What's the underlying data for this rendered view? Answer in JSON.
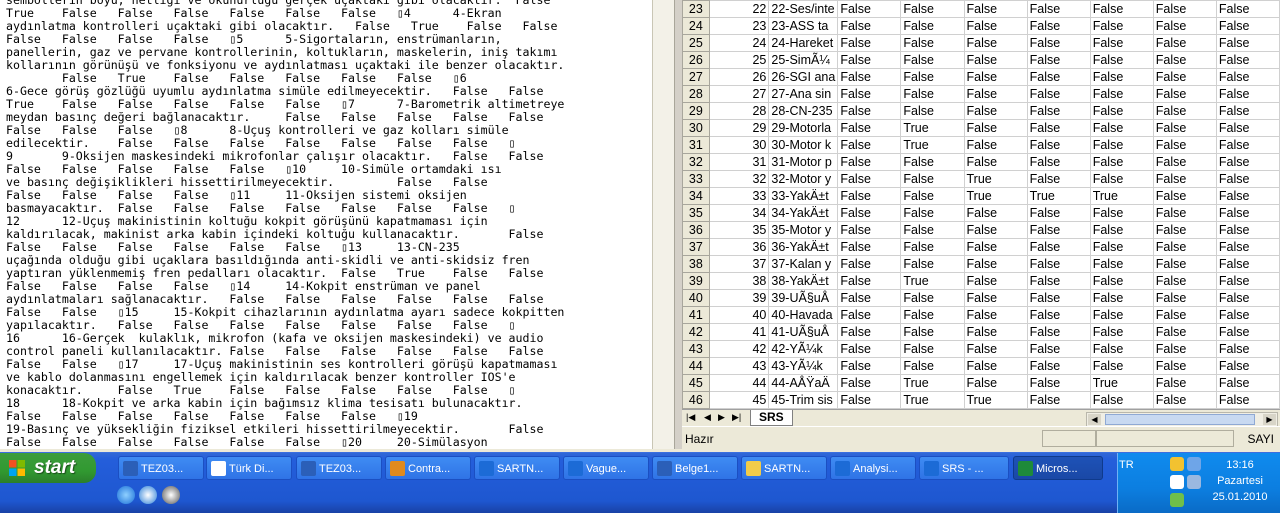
{
  "text_lines": [
    "sembollerin boyu, netliği ve okunurluğu gerçek uçaktaki gibi olacaktır.  False",
    "True    False   False   False   False   False   False   ▯4      4-Ekran",
    "aydınlatma kontrolleri uçaktaki gibi olacaktır.   False   True    False   False",
    "False   False   False   False   ▯5      5-Sigortaların, enstrümanların,",
    "panellerin, gaz ve pervane kontrollerinin, koltukların, maskelerin, iniş takımı",
    "kollarının görünüşü ve fonksiyonu ve aydınlatması uçaktaki ile benzer olacaktır.",
    "        False   True    False   False   False   False   False   ▯6",
    "6-Gece görüş gözlüğü uyumlu aydınlatma simüle edilmeyecektir.   False   False",
    "True    False   False   False   False   False   ▯7      7-Barometrik altimetreye",
    "meydan basınç değeri bağlanacaktır.     False   False   False   False   False",
    "False   False   False   ▯8      8-Uçuş kontrolleri ve gaz kolları simüle",
    "edilecektir.    False   False   False   False   False   False   False   ▯",
    "9       9-Oksijen maskesindeki mikrofonlar çalışır olacaktır.   False   False",
    "False   False   False   False   False   ▯10     10-Simüle ortamdaki ısı",
    "ve basınç değişiklikleri hissettirilmeyecektir.         False   False",
    "False   False   False   False   ▯11     11-Oksijen sistemi oksijen",
    "basmayacaktır.  False   False   False   False   False   False   False   ▯",
    "12      12-Uçuş makinistinin koltuğu kokpit görüşünü kapatmaması için",
    "kaldırılacak, makinist arka kabin içindeki koltuğu kullanacaktır.       False",
    "False   False   False   False   False   False   ▯13     13-CN-235",
    "uçağında olduğu gibi uçaklara basıldığında anti-skidli ve anti-skidsiz fren",
    "yaptıran yüklenmemiş fren pedalları olacaktır.  False   True    False   False",
    "False   False   False   False   ▯14     14-Kokpit enstrüman ve panel",
    "aydınlatmaları sağlanacaktır.   False   False   False   False   False   False",
    "False   False   ▯15     15-Kokpit cihazlarının aydınlatma ayarı sadece kokpitten",
    "yapılacaktır.   False   False   False   False   False   False   False   ▯",
    "16      16-Gerçek  kulaklık, mikrofon (kafa ve oksijen maskesindeki) ve audio",
    "control paneli kullanılacaktır. False   False   False   False   False   False",
    "False   False   ▯17     17-Uçuş makinistinin ses kontrolleri görüşü kapatmaması",
    "ve kablo dolanmasını engellemek için kaldırılacak benzer kontroller IOS'e",
    "konacaktır.     False   True    False   False   False   False   False   ▯",
    "18      18-Kokpit ve arka kabin için bağımsız klima tesisatı bulunacaktır.",
    "False   False   False   False   False   False   False   ▯19",
    "19-Basınç ve yüksekliğin fiziksel etkileri hissettirilmeyecektir.       False",
    "False   False   False   False   False   False   ▯20     20-Simülasyon"
  ],
  "sheet": {
    "rows": [
      {
        "rn": "23",
        "id": "22",
        "text": "22-Ses/inte",
        "vals": [
          "False",
          "False",
          "False",
          "False",
          "False",
          "False",
          "False"
        ]
      },
      {
        "rn": "24",
        "id": "23",
        "text": "23-ASS ta",
        "vals": [
          "False",
          "False",
          "False",
          "False",
          "False",
          "False",
          "False"
        ]
      },
      {
        "rn": "25",
        "id": "24",
        "text": "24-Hareket",
        "vals": [
          "False",
          "False",
          "False",
          "False",
          "False",
          "False",
          "False"
        ]
      },
      {
        "rn": "26",
        "id": "25",
        "text": "25-SimÃ¼",
        "vals": [
          "False",
          "False",
          "False",
          "False",
          "False",
          "False",
          "False"
        ]
      },
      {
        "rn": "27",
        "id": "26",
        "text": "26-SGI ana",
        "vals": [
          "False",
          "False",
          "False",
          "False",
          "False",
          "False",
          "False"
        ]
      },
      {
        "rn": "28",
        "id": "27",
        "text": "27-Ana sin",
        "vals": [
          "False",
          "False",
          "False",
          "False",
          "False",
          "False",
          "False"
        ]
      },
      {
        "rn": "29",
        "id": "28",
        "text": "28-CN-235",
        "vals": [
          "False",
          "False",
          "False",
          "False",
          "False",
          "False",
          "False"
        ]
      },
      {
        "rn": "30",
        "id": "29",
        "text": "29-Motorla",
        "vals": [
          "False",
          "True",
          "False",
          "False",
          "False",
          "False",
          "False"
        ]
      },
      {
        "rn": "31",
        "id": "30",
        "text": "30-Motor k",
        "vals": [
          "False",
          "True",
          "False",
          "False",
          "False",
          "False",
          "False"
        ]
      },
      {
        "rn": "32",
        "id": "31",
        "text": "31-Motor p",
        "vals": [
          "False",
          "False",
          "False",
          "False",
          "False",
          "False",
          "False"
        ]
      },
      {
        "rn": "33",
        "id": "32",
        "text": "32-Motor y",
        "vals": [
          "False",
          "False",
          "True",
          "False",
          "False",
          "False",
          "False"
        ]
      },
      {
        "rn": "34",
        "id": "33",
        "text": "33-YakÄ±t",
        "vals": [
          "False",
          "False",
          "True",
          "True",
          "True",
          "False",
          "False"
        ]
      },
      {
        "rn": "35",
        "id": "34",
        "text": "34-YakÄ±t",
        "vals": [
          "False",
          "False",
          "False",
          "False",
          "False",
          "False",
          "False"
        ]
      },
      {
        "rn": "36",
        "id": "35",
        "text": "35-Motor y",
        "vals": [
          "False",
          "False",
          "False",
          "False",
          "False",
          "False",
          "False"
        ]
      },
      {
        "rn": "37",
        "id": "36",
        "text": "36-YakÄ±t",
        "vals": [
          "False",
          "False",
          "False",
          "False",
          "False",
          "False",
          "False"
        ]
      },
      {
        "rn": "38",
        "id": "37",
        "text": "37-Kalan y",
        "vals": [
          "False",
          "False",
          "False",
          "False",
          "False",
          "False",
          "False"
        ]
      },
      {
        "rn": "39",
        "id": "38",
        "text": "38-YakÄ±t",
        "vals": [
          "False",
          "True",
          "False",
          "False",
          "False",
          "False",
          "False"
        ]
      },
      {
        "rn": "40",
        "id": "39",
        "text": "39-UÃ§uÅ",
        "vals": [
          "False",
          "False",
          "False",
          "False",
          "False",
          "False",
          "False"
        ]
      },
      {
        "rn": "41",
        "id": "40",
        "text": "40-Havada",
        "vals": [
          "False",
          "False",
          "False",
          "False",
          "False",
          "False",
          "False"
        ]
      },
      {
        "rn": "42",
        "id": "41",
        "text": "41-UÃ§uÅ",
        "vals": [
          "False",
          "False",
          "False",
          "False",
          "False",
          "False",
          "False"
        ]
      },
      {
        "rn": "43",
        "id": "42",
        "text": "42-YÃ¼k",
        "vals": [
          "False",
          "False",
          "False",
          "False",
          "False",
          "False",
          "False"
        ]
      },
      {
        "rn": "44",
        "id": "43",
        "text": "43-YÃ¼k",
        "vals": [
          "False",
          "False",
          "False",
          "False",
          "False",
          "False",
          "False"
        ]
      },
      {
        "rn": "45",
        "id": "44",
        "text": "44-AÅŸaÄ",
        "vals": [
          "False",
          "True",
          "False",
          "False",
          "True",
          "False",
          "False"
        ]
      },
      {
        "rn": "46",
        "id": "45",
        "text": "45-Trim sis",
        "vals": [
          "False",
          "True",
          "True",
          "False",
          "False",
          "False",
          "False"
        ]
      }
    ],
    "tab_label": "SRS",
    "status_text": "Hazır",
    "status_mode": "SAYI"
  },
  "taskbar": {
    "start_label": "start",
    "tasks": [
      {
        "label": "TEZ03...",
        "color": "#2b5fb8"
      },
      {
        "label": "Türk Di...",
        "color": "#ffffff"
      },
      {
        "label": "TEZ03...",
        "color": "#2b5fb8"
      },
      {
        "label": "Contra...",
        "color": "#e08a1e"
      },
      {
        "label": "SARTN...",
        "color": "#1c6bd6"
      },
      {
        "label": "Vague...",
        "color": "#1c6bd6"
      },
      {
        "label": "Belge1...",
        "color": "#2b5fb8"
      },
      {
        "label": "SARTN...",
        "color": "#f2cc4a"
      },
      {
        "label": "Analysi...",
        "color": "#1c6bd6"
      },
      {
        "label": "SRS - ...",
        "color": "#1c6bd6"
      },
      {
        "label": "Micros...",
        "color": "#1e8a3a"
      }
    ],
    "lang": "TR",
    "time": "13:16",
    "day": "Pazartesi",
    "date": "25.01.2010"
  }
}
